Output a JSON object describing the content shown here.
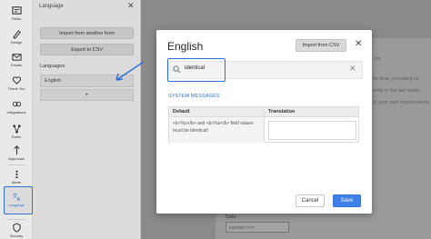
{
  "rail": {
    "items": [
      {
        "label": "Fields",
        "icon": "fields-icon"
      },
      {
        "label": "Design",
        "icon": "design-icon"
      },
      {
        "label": "Emails",
        "icon": "email-icon"
      },
      {
        "label": "Thank You",
        "icon": "thank-you-icon"
      },
      {
        "label": "Integrations",
        "icon": "integrations-icon"
      },
      {
        "label": "Rules",
        "icon": "rules-icon"
      },
      {
        "label": "Approvals",
        "icon": "approvals-icon"
      },
      {
        "label": "Alerts",
        "icon": "alerts-icon"
      },
      {
        "label": "Language",
        "icon": "language-icon"
      },
      {
        "label": "Security",
        "icon": "security-icon"
      }
    ],
    "active": "Language"
  },
  "language_panel": {
    "title": "Language",
    "import_label": "Import from another form",
    "export_label": "Export to CSV",
    "languages_heading": "Languages",
    "languages": [
      "English"
    ],
    "add_label": "+"
  },
  "background": {
    "texts": [
      "on time, providing us",
      "ently in the last week.",
      "to your own requirements.",
      "rm"
    ],
    "date_label": "Date",
    "date_placeholder": "MM/DD/YYYY"
  },
  "modal": {
    "title": "English",
    "import_csv_label": "Import from CSV",
    "search_value": "identical",
    "section_heading": "SYSTEM MESSAGES",
    "columns": [
      "Default",
      "Translation"
    ],
    "rows": [
      {
        "default": "<b>%s</b> and <b>%s</b> field values must be identical!",
        "translation": ""
      }
    ],
    "cancel_label": "Cancel",
    "save_label": "Save"
  },
  "colors": {
    "accent": "#2f6fd6",
    "save_button": "#3f80e8"
  }
}
